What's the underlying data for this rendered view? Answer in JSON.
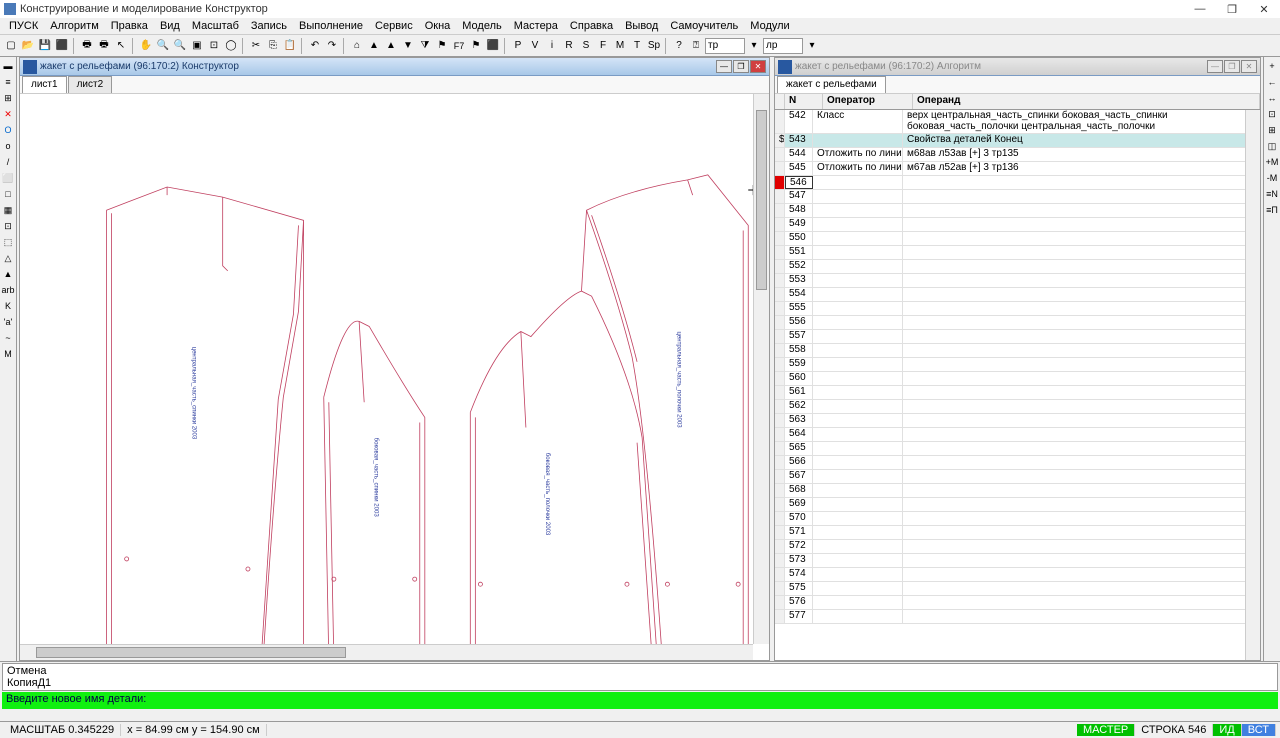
{
  "app": {
    "title": "Конструирование и моделирование  Конструктор"
  },
  "menu": [
    "ПУСК",
    "Алгоритм",
    "Правка",
    "Вид",
    "Масштаб",
    "Запись",
    "Выполнение",
    "Сервис",
    "Окна",
    "Модель",
    "Мастера",
    "Справка",
    "Вывод",
    "Самоучитель",
    "Модули"
  ],
  "toolbar_inputs": {
    "left": "тр",
    "right": "лр"
  },
  "toolbar_letters": [
    "P",
    "V",
    "i",
    "R",
    "S",
    "F",
    "M",
    "T",
    "Sp"
  ],
  "panels": {
    "left": {
      "title": "жакет с рельефами (96:170:2) Конструктор",
      "tabs": [
        "лист1",
        "лист2"
      ]
    },
    "right": {
      "title": "жакет с рельефами (96:170:2) Алгоритм",
      "tab": "жакет с рельефами"
    }
  },
  "grid": {
    "headers": {
      "n": "N",
      "operator": "Оператор",
      "operand": "Операнд"
    },
    "rows": [
      {
        "n": "542",
        "op": "Класс",
        "oper": "верх центральная_часть_спинки боковая_часть_спинки боковая_часть_полочки центральная_часть_полочки верхняя_часть_рукава нижняя_часть_рукава",
        "tall": true
      },
      {
        "n": "543",
        "op": "",
        "oper": "Свойства деталей Конец",
        "hl": true,
        "mark": "$"
      },
      {
        "n": "544",
        "op": "Отложить по линии",
        "oper": "м68ав л53ав [+] 3 тр135"
      },
      {
        "n": "545",
        "op": "Отложить по линии",
        "oper": "м67ав л52ав [+] 3 тр136"
      },
      {
        "n": "546",
        "op": "",
        "oper": "",
        "active": true
      },
      {
        "n": "547",
        "op": "",
        "oper": ""
      },
      {
        "n": "548",
        "op": "",
        "oper": ""
      },
      {
        "n": "549",
        "op": "",
        "oper": ""
      },
      {
        "n": "550",
        "op": "",
        "oper": ""
      },
      {
        "n": "551",
        "op": "",
        "oper": ""
      },
      {
        "n": "552",
        "op": "",
        "oper": ""
      },
      {
        "n": "553",
        "op": "",
        "oper": ""
      },
      {
        "n": "554",
        "op": "",
        "oper": ""
      },
      {
        "n": "555",
        "op": "",
        "oper": ""
      },
      {
        "n": "556",
        "op": "",
        "oper": ""
      },
      {
        "n": "557",
        "op": "",
        "oper": ""
      },
      {
        "n": "558",
        "op": "",
        "oper": ""
      },
      {
        "n": "559",
        "op": "",
        "oper": ""
      },
      {
        "n": "560",
        "op": "",
        "oper": ""
      },
      {
        "n": "561",
        "op": "",
        "oper": ""
      },
      {
        "n": "562",
        "op": "",
        "oper": ""
      },
      {
        "n": "563",
        "op": "",
        "oper": ""
      },
      {
        "n": "564",
        "op": "",
        "oper": ""
      },
      {
        "n": "565",
        "op": "",
        "oper": ""
      },
      {
        "n": "566",
        "op": "",
        "oper": ""
      },
      {
        "n": "567",
        "op": "",
        "oper": ""
      },
      {
        "n": "568",
        "op": "",
        "oper": ""
      },
      {
        "n": "569",
        "op": "",
        "oper": ""
      },
      {
        "n": "570",
        "op": "",
        "oper": ""
      },
      {
        "n": "571",
        "op": "",
        "oper": ""
      },
      {
        "n": "572",
        "op": "",
        "oper": ""
      },
      {
        "n": "573",
        "op": "",
        "oper": ""
      },
      {
        "n": "574",
        "op": "",
        "oper": ""
      },
      {
        "n": "575",
        "op": "",
        "oper": ""
      },
      {
        "n": "576",
        "op": "",
        "oper": ""
      },
      {
        "n": "577",
        "op": "",
        "oper": ""
      }
    ]
  },
  "log": {
    "line1": "Отмена",
    "line2": "КопияД1"
  },
  "prompt": "Введите новое имя детали:",
  "status": {
    "scale": "МАСШТАБ 0.345229",
    "coords": "x = 84.99 см   y = 154.90 см",
    "master": "МАСТЕР",
    "row": "СТРОКА 546",
    "id": "ИД",
    "vst": "ВСТ"
  },
  "left_tools": [
    "▬",
    "≡",
    "⊞",
    "✕",
    "O",
    "o",
    "/",
    "⬜",
    "□",
    "▦",
    "⊡",
    "⬚",
    "△",
    "▲",
    "arb",
    "K",
    "'a'",
    "~",
    "M"
  ],
  "right_tools": [
    "+",
    "←",
    "↔",
    "⊡",
    "⊞",
    "◫",
    "+M",
    "-M",
    "≡N",
    "≡П"
  ]
}
